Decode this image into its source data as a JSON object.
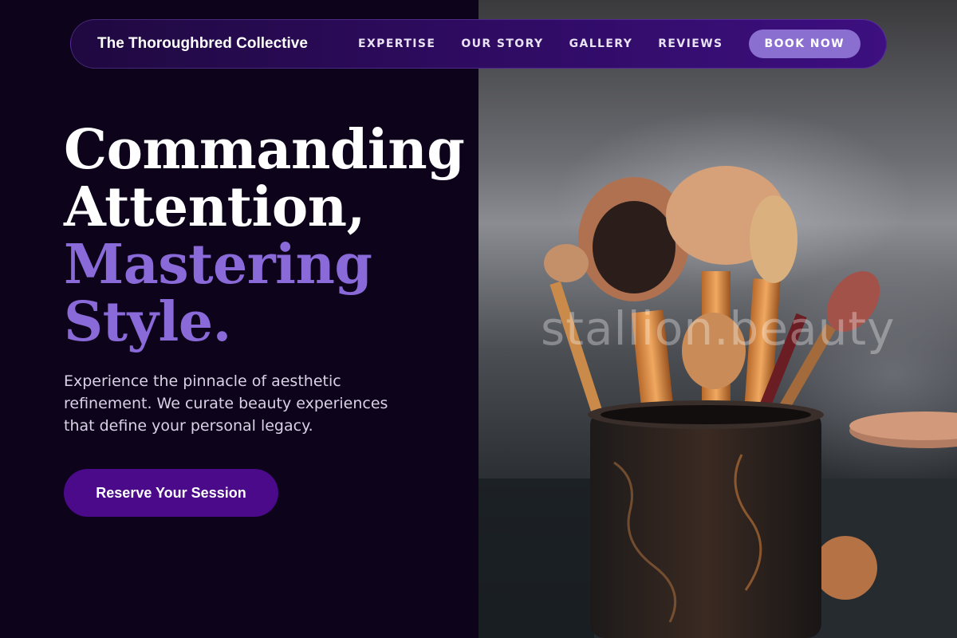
{
  "nav": {
    "brand": "The Thoroughbred Collective",
    "links": [
      "EXPERTISE",
      "OUR STORY",
      "GALLERY",
      "REVIEWS"
    ],
    "book_label": "BOOK NOW"
  },
  "hero": {
    "headline_lines": [
      "Commanding",
      "Attention,",
      "Mastering",
      "Style."
    ],
    "subtitle": "Experience the pinnacle of aesthetic refinement. We curate beauty experiences that define your personal legacy.",
    "cta_label": "Reserve Your Session",
    "image_watermark": "stallion.beauty"
  },
  "colors": {
    "background": "#0d031b",
    "accent": "#8a6ad8",
    "nav_gradient_end": "#3d0f80",
    "cta": "#4a0a8a",
    "book_button": "#8a6fd1"
  }
}
